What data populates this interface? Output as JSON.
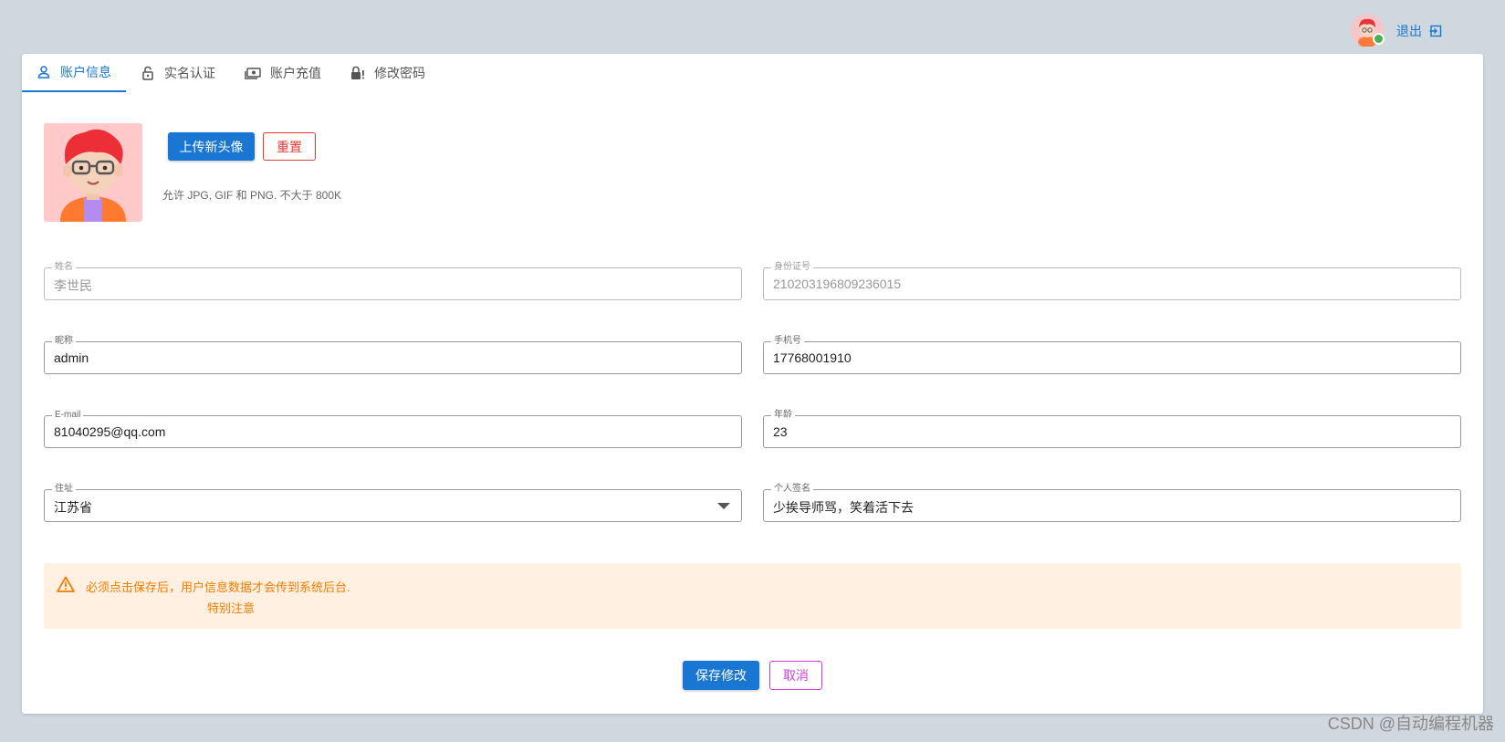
{
  "header": {
    "logout_label": "退出"
  },
  "tabs": [
    {
      "label": "账户信息",
      "icon": "person-icon",
      "active": true
    },
    {
      "label": "实名认证",
      "icon": "lock-open-icon",
      "active": false
    },
    {
      "label": "账户充值",
      "icon": "cash-icon",
      "active": false
    },
    {
      "label": "修改密码",
      "icon": "lock-alert-icon",
      "active": false
    }
  ],
  "profile": {
    "upload_label": "上传新头像",
    "reset_label": "重置",
    "hint": "允许 JPG, GIF 和 PNG. 不大于 800K"
  },
  "form": {
    "name": {
      "label": "姓名",
      "value": "李世民"
    },
    "id_number": {
      "label": "身份证号",
      "value": "210203196809236015"
    },
    "nickname": {
      "label": "昵称",
      "value": "admin"
    },
    "phone": {
      "label": "手机号",
      "value": "17768001910"
    },
    "email": {
      "label": "E-mail",
      "value": "81040295@qq.com"
    },
    "age": {
      "label": "年龄",
      "value": "23"
    },
    "address": {
      "label": "住址",
      "value": "江苏省"
    },
    "signature": {
      "label": "个人签名",
      "value": "少挨导师骂，笑着活下去"
    }
  },
  "alert": {
    "line1": "必须点击保存后，用户信息数据才会传到系统后台.",
    "line2": "特别注意"
  },
  "actions": {
    "save_label": "保存修改",
    "cancel_label": "取消"
  },
  "watermark": "CSDN @自动编程机器",
  "colors": {
    "primary": "#1976d2",
    "danger": "#e53935",
    "warning_bg": "#fff0e1",
    "warning_text": "#f57c00",
    "cancel": "#d63ee0",
    "page_bg": "#cfd8df"
  }
}
